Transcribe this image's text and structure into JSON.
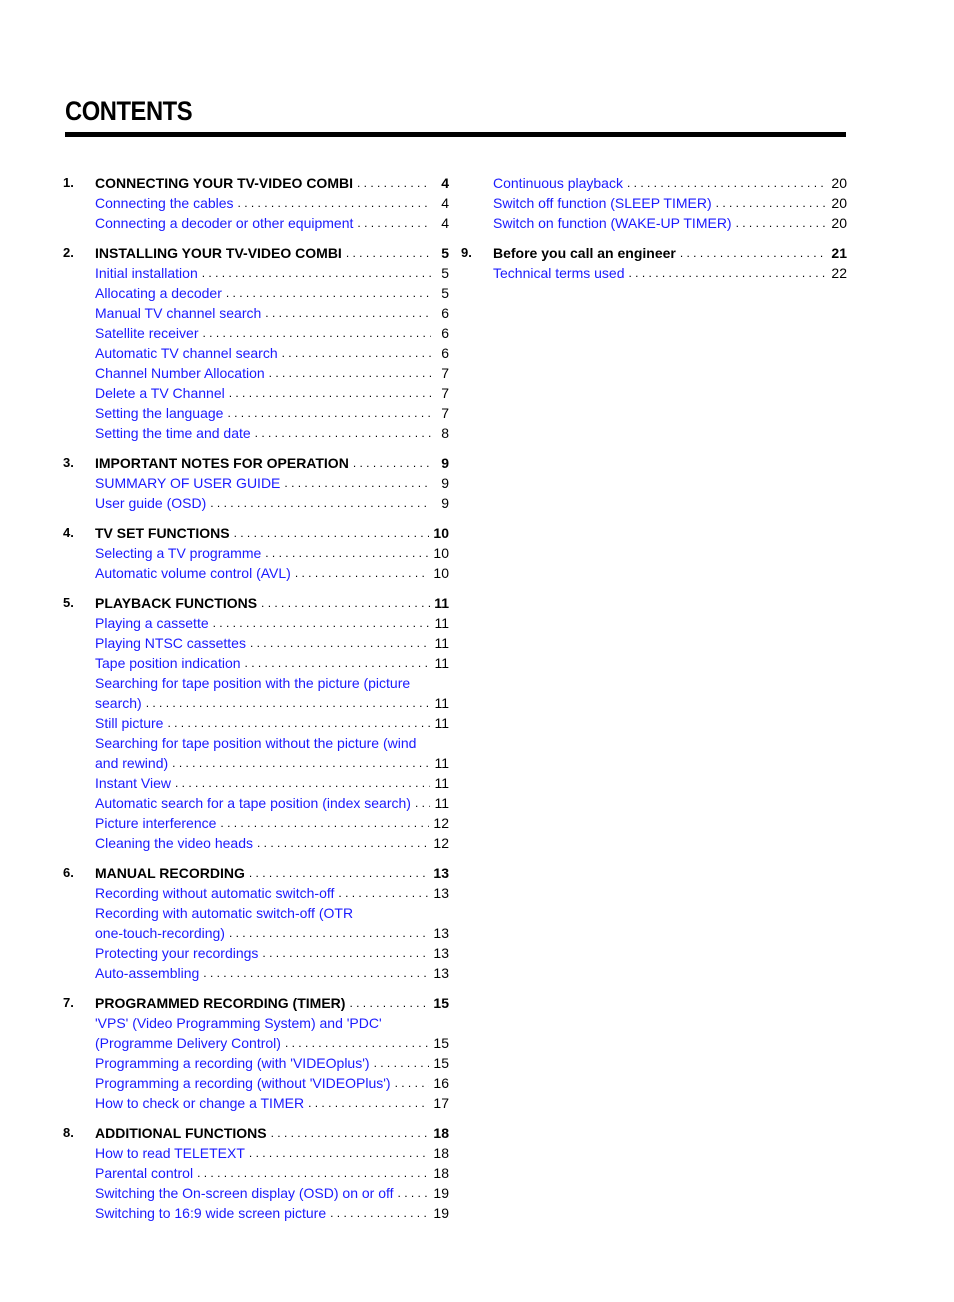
{
  "title": "CONTENTS",
  "columns": [
    {
      "sections": [
        {
          "number": "1.",
          "title": "CONNECTING YOUR TV-VIDEO COMBI",
          "page": "4",
          "entries": [
            {
              "label": "Connecting the cables",
              "page": "4"
            },
            {
              "label": "Connecting a decoder or other equipment",
              "page": "4"
            }
          ]
        },
        {
          "number": "2.",
          "title": "INSTALLING YOUR TV-VIDEO COMBI",
          "page": "5",
          "entries": [
            {
              "label": "Initial installation",
              "page": "5"
            },
            {
              "label": "Allocating a decoder",
              "page": "5"
            },
            {
              "label": "Manual TV channel search",
              "page": "6"
            },
            {
              "label": "Satellite receiver",
              "page": "6"
            },
            {
              "label": "Automatic TV channel search",
              "page": "6"
            },
            {
              "label": "Channel Number Allocation",
              "page": "7"
            },
            {
              "label": "Delete a TV Channel",
              "page": "7"
            },
            {
              "label": "Setting the language",
              "page": "7"
            },
            {
              "label": "Setting the time and date",
              "page": "8"
            }
          ]
        },
        {
          "number": "3.",
          "title": "IMPORTANT NOTES FOR OPERATION",
          "page": "9",
          "entries": [
            {
              "label": "SUMMARY OF USER GUIDE",
              "page": "9"
            },
            {
              "label": "User guide (OSD)",
              "page": "9"
            }
          ]
        },
        {
          "number": "4.",
          "title": "TV SET FUNCTIONS",
          "page": "10",
          "entries": [
            {
              "label": "Selecting a TV programme",
              "page": "10"
            },
            {
              "label": "Automatic volume control (AVL)",
              "page": "10"
            }
          ]
        },
        {
          "number": "5.",
          "title": "PLAYBACK FUNCTIONS",
          "page": "11",
          "entries": [
            {
              "label": "Playing a cassette",
              "page": "11"
            },
            {
              "label": "Playing NTSC cassettes",
              "page": "11"
            },
            {
              "label": "Tape position indication",
              "page": "11"
            },
            {
              "label_line1": "Searching for tape position with the picture (picture",
              "label": "search)",
              "page": "11"
            },
            {
              "label": "Still picture",
              "page": "11"
            },
            {
              "label_line1": "Searching for tape position without the picture (wind",
              "label": "and rewind)",
              "page": "11"
            },
            {
              "label": "Instant View",
              "page": "11"
            },
            {
              "label": "Automatic search for a tape position (index search)",
              "page": "11"
            },
            {
              "label": "Picture interference",
              "page": "12"
            },
            {
              "label": "Cleaning the video heads",
              "page": "12"
            }
          ]
        },
        {
          "number": "6.",
          "title": "MANUAL RECORDING",
          "page": "13",
          "entries": [
            {
              "label": "Recording without automatic switch-off",
              "page": "13"
            },
            {
              "label_line1": "Recording with automatic switch-off (OTR",
              "label": "one-touch-recording)",
              "page": "13"
            },
            {
              "label": "Protecting your recordings",
              "page": "13"
            },
            {
              "label": "Auto-assembling",
              "page": "13"
            }
          ]
        },
        {
          "number": "7.",
          "title": "PROGRAMMED RECORDING (TIMER)",
          "page": "15",
          "entries": [
            {
              "label_line1": "'VPS' (Video Programming System) and 'PDC'",
              "label": "(Programme Delivery Control)",
              "page": "15"
            },
            {
              "label": "Programming a recording (with 'VIDEOplus')",
              "page": "15"
            },
            {
              "label": "Programming a recording (without 'VIDEOPlus')",
              "page": "16"
            },
            {
              "label": "How to check or change a TIMER",
              "page": "17"
            }
          ]
        },
        {
          "number": "8.",
          "title": "ADDITIONAL FUNCTIONS",
          "page": "18",
          "entries": [
            {
              "label": "How to read TELETEXT",
              "page": "18"
            },
            {
              "label": "Parental control",
              "page": "18"
            },
            {
              "label": "Switching the On-screen display (OSD) on or off",
              "page": "19"
            },
            {
              "label": "Switching to 16:9 wide screen picture",
              "page": "19"
            }
          ]
        }
      ]
    },
    {
      "sections": [
        {
          "number": "",
          "title": "",
          "page": "",
          "entries": [
            {
              "label": "Continuous playback",
              "page": "20"
            },
            {
              "label": "Switch off function (SLEEP TIMER)",
              "page": "20"
            },
            {
              "label": "Switch on function (WAKE-UP TIMER)",
              "page": "20"
            }
          ]
        },
        {
          "number": "9.",
          "title": "Before you call an engineer",
          "page": "21",
          "entries": [
            {
              "label": "Technical terms used",
              "page": "22"
            }
          ]
        }
      ]
    }
  ]
}
